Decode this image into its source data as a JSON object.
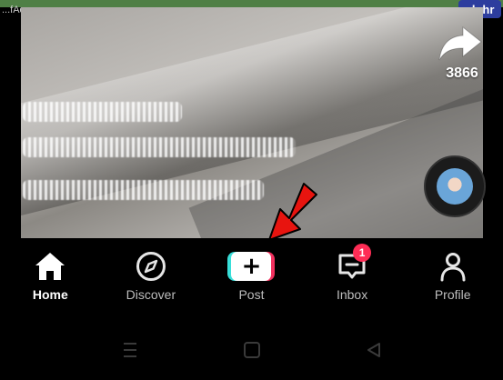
{
  "watermark": {
    "site_text": "...fAq.com",
    "brand": "alphr"
  },
  "video": {
    "share_count": "3866"
  },
  "nav": {
    "items": [
      {
        "label": "Home",
        "icon": "home-icon",
        "active": true
      },
      {
        "label": "Discover",
        "icon": "compass-icon",
        "active": false
      },
      {
        "label": "Post",
        "icon": "plus-icon",
        "active": false
      },
      {
        "label": "Inbox",
        "icon": "inbox-icon",
        "active": false,
        "badge": "1"
      },
      {
        "label": "Profile",
        "icon": "person-icon",
        "active": false
      }
    ]
  },
  "system_nav": {
    "buttons": [
      "recents-icon",
      "home-square-icon",
      "back-triangle-icon"
    ]
  },
  "colors": {
    "accent_pink": "#fe2c55",
    "accent_cyan": "#38ded9",
    "annotation_red": "#e8140f"
  }
}
